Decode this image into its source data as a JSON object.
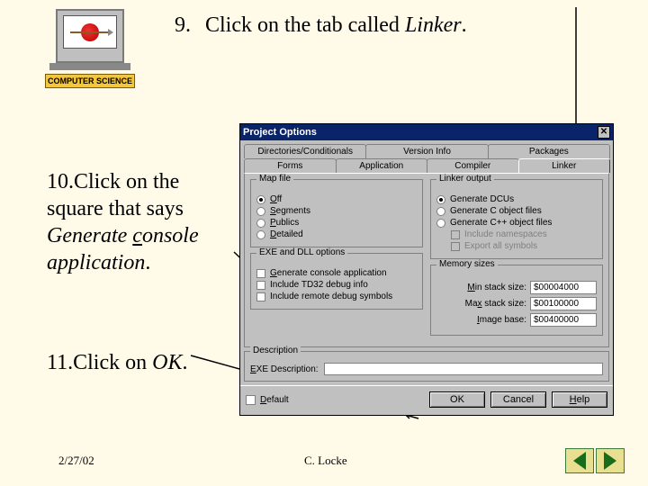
{
  "badge": {
    "label": "COMPUTER SCIENCE"
  },
  "steps": {
    "s9": {
      "num": "9.",
      "pre": "Click on the tab called ",
      "target": "Linker",
      "post": "."
    },
    "s10": {
      "num": "10.",
      "pre": "Click on the square that says ",
      "it1": "Generate ",
      "it2_u": "c",
      "it3": "onsole application",
      "post": "."
    },
    "s11": {
      "num": "11.",
      "pre": "Click on ",
      "target": "OK",
      "post": "."
    }
  },
  "footer": {
    "date": "2/27/02",
    "author": "C. Locke"
  },
  "dialog": {
    "title": "Project Options",
    "tabs_row1": [
      "Directories/Conditionals",
      "Version Info",
      "Packages"
    ],
    "tabs_row2": [
      "Forms",
      "Application",
      "Compiler",
      "Linker"
    ],
    "active_tab": "Linker",
    "mapfile": {
      "title": "Map file",
      "options": [
        {
          "label": "Off",
          "selected": true,
          "underline": "O"
        },
        {
          "label": "Segments",
          "selected": false,
          "underline": "S"
        },
        {
          "label": "Publics",
          "selected": false,
          "underline": "P"
        },
        {
          "label": "Detailed",
          "selected": false,
          "underline": "D"
        }
      ]
    },
    "linker_output": {
      "title": "Linker output",
      "options": [
        {
          "label": "Generate DCUs",
          "selected": true
        },
        {
          "label": "Generate C object files",
          "selected": false
        },
        {
          "label": "Generate C++ object files",
          "selected": false
        }
      ],
      "sub_checks": [
        {
          "label": "Include namespaces",
          "disabled": true
        },
        {
          "label": "Export all symbols",
          "disabled": true
        }
      ]
    },
    "exe_dll": {
      "title": "EXE and DLL options",
      "checks": [
        {
          "label": "Generate console application",
          "underline": "G"
        },
        {
          "label": "Include TD32 debug info"
        },
        {
          "label": "Include remote debug symbols"
        }
      ]
    },
    "memory": {
      "title": "Memory sizes",
      "rows": [
        {
          "label": "Min stack size:",
          "underline": "M",
          "value": "$00004000"
        },
        {
          "label": "Max stack size:",
          "underline": "x",
          "value": "$00100000"
        },
        {
          "label": "Image base:",
          "underline": "I",
          "value": "$00400000"
        }
      ]
    },
    "description": {
      "title": "Description",
      "label": "EXE Description:",
      "underline": "E",
      "value": ""
    },
    "default_label": "Default",
    "default_underline": "D",
    "buttons": {
      "ok": "OK",
      "cancel": "Cancel",
      "help": "Help",
      "help_underline": "H"
    }
  }
}
